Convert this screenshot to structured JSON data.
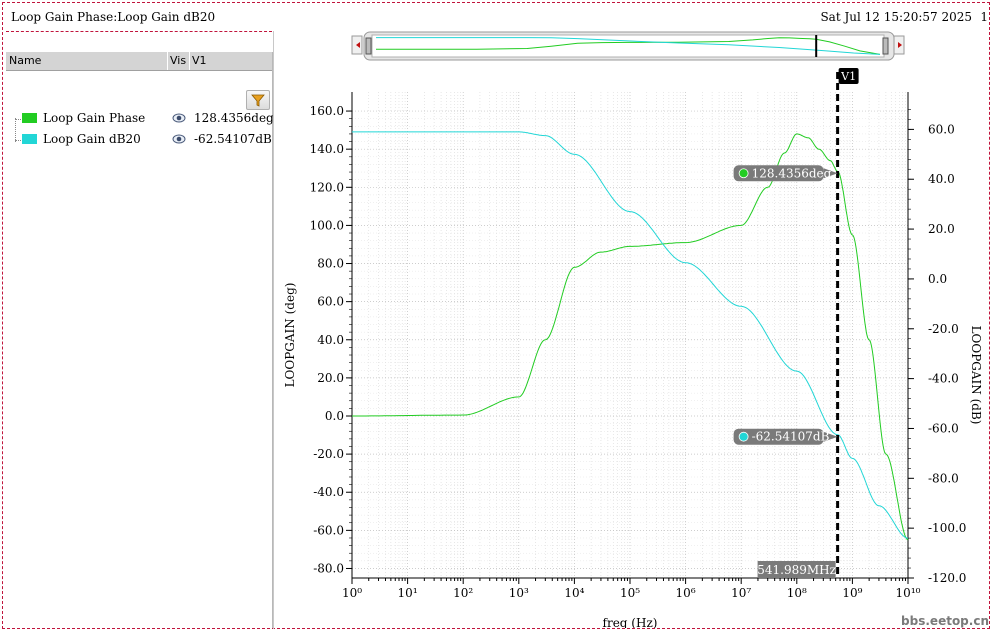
{
  "header": {
    "title": "Loop Gain Phase:Loop Gain dB20",
    "date": "Sat Jul 12 15:20:57 2025",
    "page": "1"
  },
  "trace_panel": {
    "columns": {
      "name": "Name",
      "vis": "Vis",
      "v1": "V1"
    },
    "traces": [
      {
        "name": "Loop Gain Phase",
        "value": "128.4356deg",
        "color": "#22cc22",
        "icon": "eye-icon"
      },
      {
        "name": "Loop Gain dB20",
        "value": "-62.54107dB",
        "color": "#22d6d6",
        "icon": "eye-icon"
      }
    ],
    "filter_icon": "filter-icon"
  },
  "marker": {
    "name": "V1",
    "freq_label": "541.989MHz",
    "phase_label": "128.4356deg",
    "gain_label": "-62.54107dB",
    "freq_hz": 541989000
  },
  "watermark": "bbs.eetop.cn",
  "chart_data": {
    "type": "line",
    "xlabel": "freq (Hz)",
    "ylabel_left": "LOOPGAIN (deg)",
    "ylabel_right": "LOOPGAIN (dB)",
    "x_scale": "log",
    "xlim": [
      1,
      10000000000
    ],
    "ylim_left": [
      -85,
      170
    ],
    "ylim_right": [
      -120,
      75
    ],
    "x_ticks": [
      "10⁰",
      "10¹",
      "10²",
      "10³",
      "10⁴",
      "10⁵",
      "10⁶",
      "10⁷",
      "10⁸",
      "10⁹",
      "10¹⁰"
    ],
    "y_ticks_left": [
      "160.0",
      "140.0",
      "120.0",
      "100.0",
      "80.0",
      "60.0",
      "40.0",
      "20.0",
      "0.0",
      "-20.0",
      "-40.0",
      "-60.0",
      "-80.0"
    ],
    "y_ticks_right": [
      "60.0",
      "40.0",
      "20.0",
      "0.0",
      "-20.0",
      "-40.0",
      "-60.0",
      "-80.0",
      "-100.0",
      "-120.0"
    ],
    "grid": true,
    "series": [
      {
        "name": "Loop Gain Phase",
        "axis": "left",
        "color": "#22cc22",
        "x": [
          1,
          100,
          1000,
          3000,
          10000,
          30000,
          100000,
          1000000,
          10000000,
          30000000,
          60000000,
          100000000,
          160000000,
          250000000,
          400000000,
          541989000,
          1000000000,
          2000000000,
          4000000000,
          10000000000
        ],
        "y": [
          0,
          0.5,
          10,
          40,
          78,
          86,
          89,
          91,
          100,
          120,
          138,
          148,
          146,
          140,
          134,
          128.4,
          95,
          40,
          -20,
          -65
        ]
      },
      {
        "name": "Loop Gain dB20",
        "axis": "right",
        "color": "#22d6d6",
        "x": [
          1,
          1000,
          3000,
          10000,
          100000,
          1000000,
          10000000,
          100000000,
          541989000,
          1000000000,
          3000000000,
          10000000000
        ],
        "y": [
          59,
          59,
          57.5,
          50,
          27,
          6.5,
          -11,
          -37,
          -62.5,
          -72,
          -91,
          -104
        ]
      }
    ]
  }
}
